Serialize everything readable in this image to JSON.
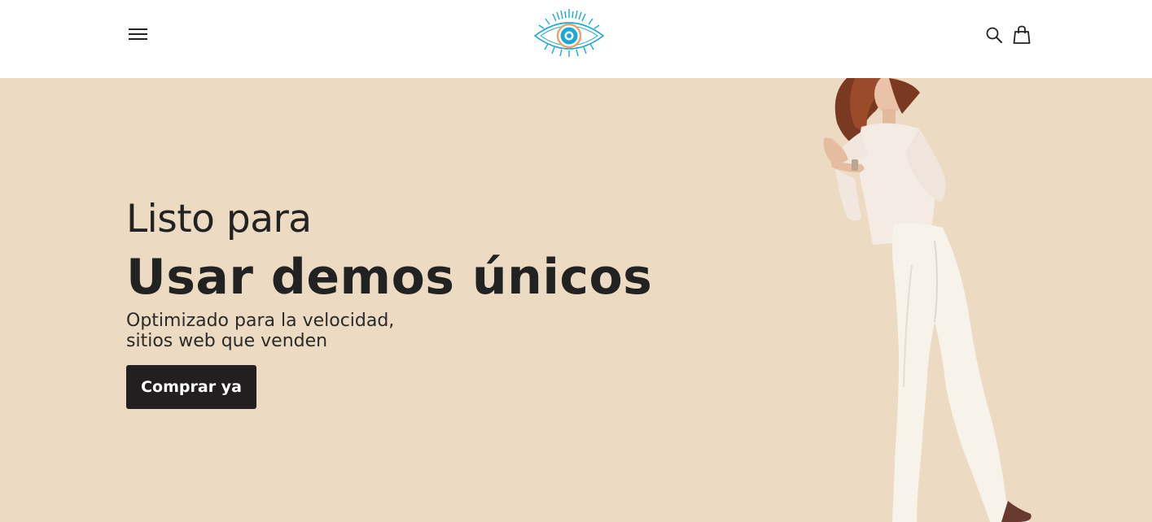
{
  "header": {
    "logo_alt": "evil eye logo",
    "menu_icon": "hamburger-menu-icon",
    "search_icon": "search-icon",
    "cart_icon": "shopping-bag-icon"
  },
  "hero": {
    "kicker": "Listo para",
    "headline": "Usar demos únicos",
    "subtitle_line1": "Optimizado para la velocidad,",
    "subtitle_line2": "sitios web que venden",
    "cta_label": "Comprar ya",
    "background_color": "#ecdbc2",
    "image": "model-photo"
  },
  "colors": {
    "text": "#222222",
    "button": "#231f20",
    "logo_accent": "#1aa9d2",
    "logo_iris": "#e6a56b"
  }
}
